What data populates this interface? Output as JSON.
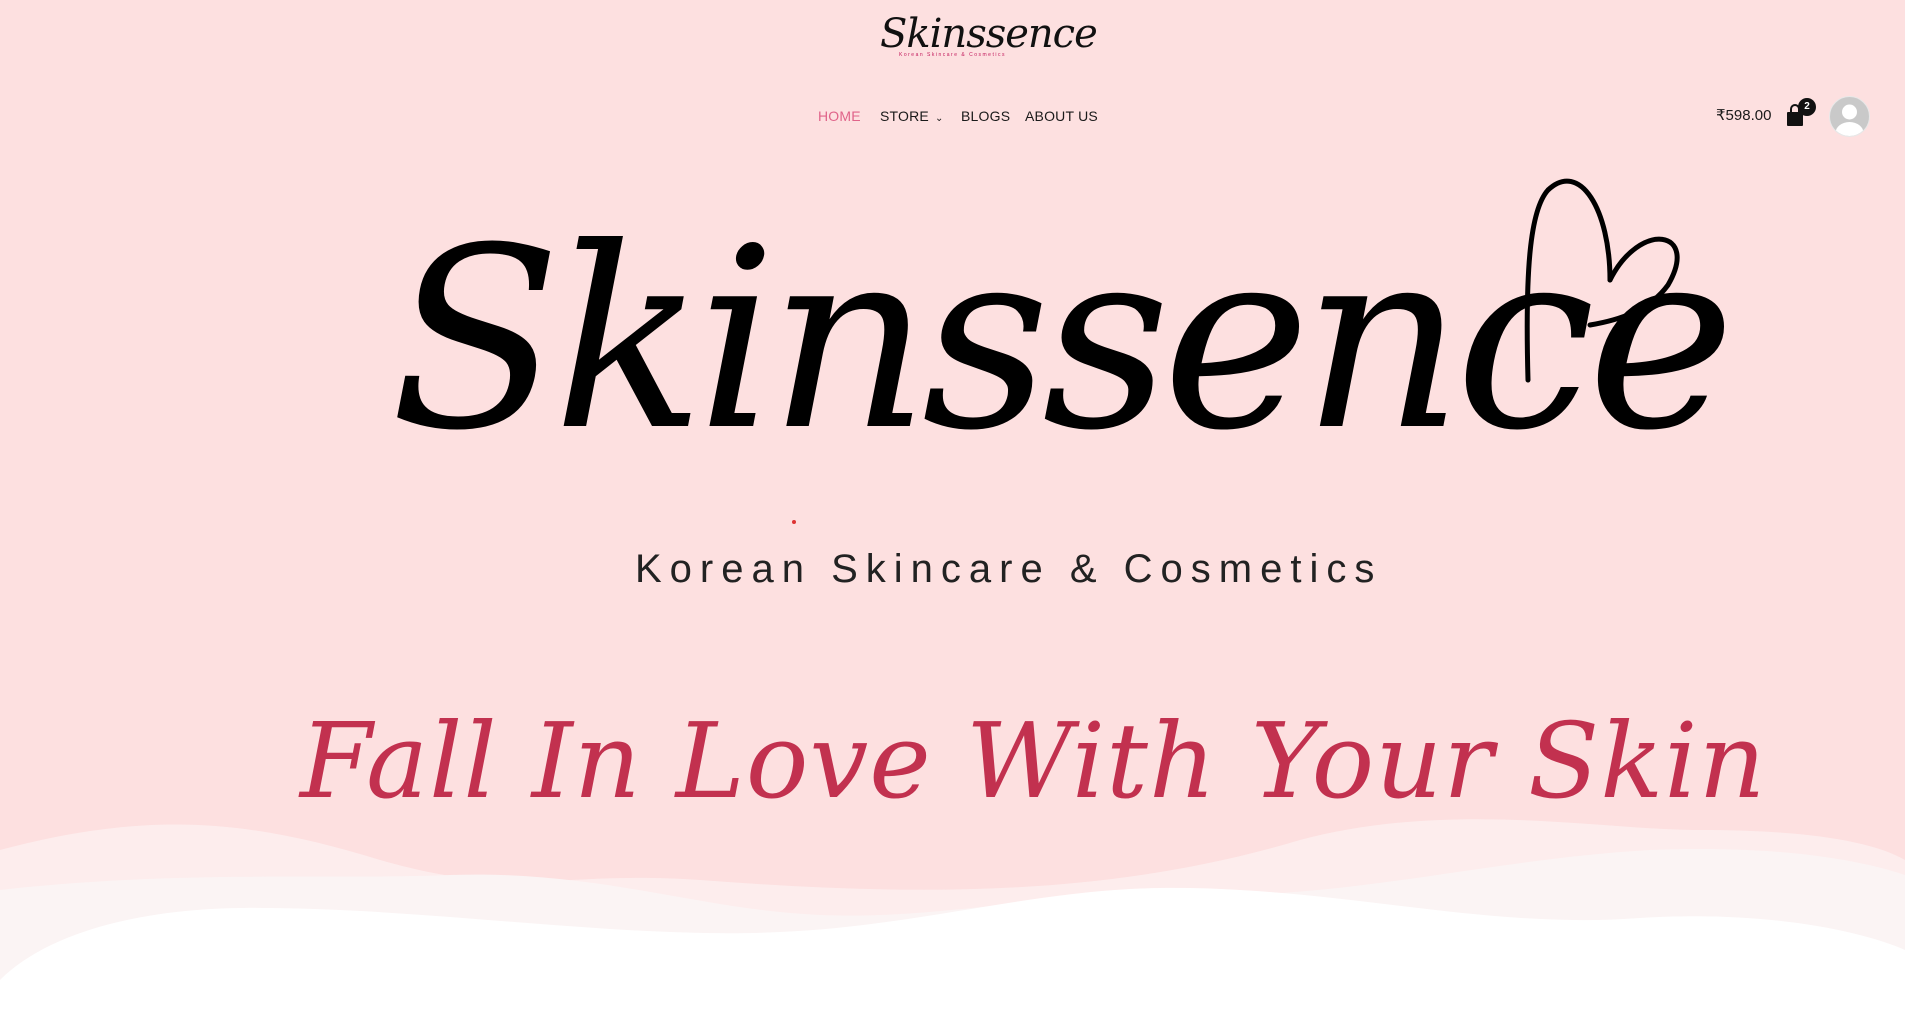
{
  "brand": {
    "small_logo_script": "Skinssence",
    "small_logo_tagline": "Korean Skincare & Cosmetics"
  },
  "nav": {
    "items": [
      {
        "label": "HOME",
        "active": true
      },
      {
        "label": "STORE",
        "has_dropdown": true
      },
      {
        "label": "BLOGS"
      },
      {
        "label": "ABOUT US"
      }
    ],
    "active_color": "#e0648a"
  },
  "cart": {
    "total": "₹598.00",
    "count": "2",
    "icon": "shopping-bag-icon"
  },
  "account": {
    "icon": "user-avatar-icon"
  },
  "hero": {
    "logo_script": "Skinssence",
    "logo_tagline": "Korean Skincare & Cosmetics",
    "heart_icon": "heart-icon",
    "slogan": "Fall In Love With Your Skin"
  },
  "colors": {
    "background": "#fde0e0",
    "slogan": "#c2314f",
    "wave_light": "#fdf0f0",
    "wave_white": "#ffffff"
  }
}
